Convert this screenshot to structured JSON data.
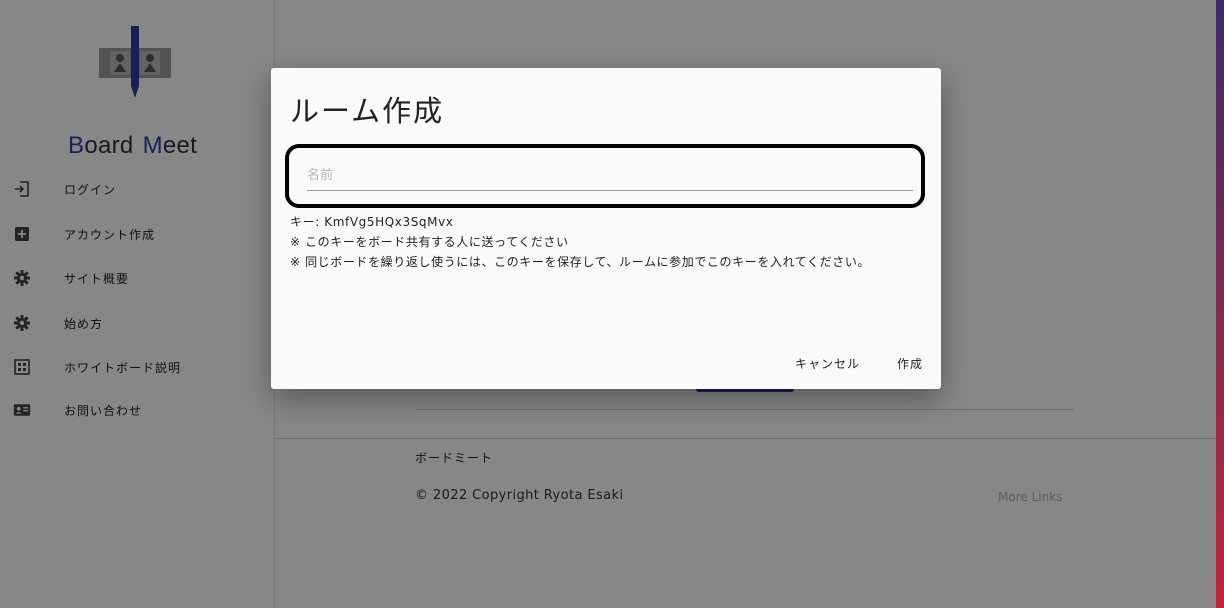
{
  "sidebar": {
    "brand_b": "B",
    "brand_oard": "oard",
    "brand_m": "M",
    "brand_eet": "eet",
    "items": [
      {
        "label": "ログイン",
        "icon": "login-icon"
      },
      {
        "label": "アカウント作成",
        "icon": "add-box-icon"
      },
      {
        "label": "サイト概要",
        "icon": "gear-icon"
      },
      {
        "label": "始め方",
        "icon": "gear-icon"
      },
      {
        "label": "ホワイトボード説明",
        "icon": "dashboard-icon"
      },
      {
        "label": "お問い合わせ",
        "icon": "contact-card-icon"
      }
    ]
  },
  "footer": {
    "title": "ボードミート",
    "copyright": "© 2022 Copyright Ryota Esaki",
    "right_text": "More Links"
  },
  "dialog": {
    "title": "ルーム作成",
    "name_placeholder": "名前",
    "name_value": "",
    "key_line": "キー: KmfVg5HQx3SqMvx",
    "note1": "※ このキーをボード共有する人に送ってください",
    "note2": "※ 同じボードを繰り返し使うには、このキーを保存して、ルームに参加でこのキーを入れてください。",
    "cancel_label": "キャンセル",
    "create_label": "作成"
  },
  "colors": {
    "brand_accent": "#2e3ca0",
    "overlay": "rgba(0,0,0,0.46)"
  }
}
